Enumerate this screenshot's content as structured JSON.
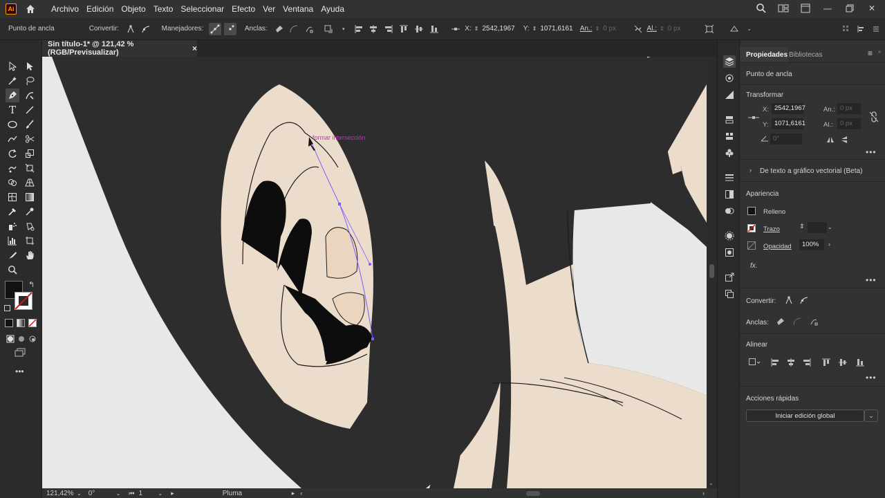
{
  "app": {
    "logo": "Ai"
  },
  "menubar": {
    "items": [
      "Archivo",
      "Edición",
      "Objeto",
      "Texto",
      "Seleccionar",
      "Efecto",
      "Ver",
      "Ventana",
      "Ayuda"
    ]
  },
  "controlbar": {
    "mode_label": "Punto de ancla",
    "convertir_label": "Convertir:",
    "manejadores_label": "Manejadores:",
    "anclas_label": "Anclas:",
    "x_label": "X:",
    "x_value": "2542,1967",
    "y_label": "Y:",
    "y_value": "1071,6161",
    "an_label": "An.:",
    "an_value": "0 px",
    "al_label": "Al.:",
    "al_value": "0 px"
  },
  "document": {
    "tab_title": "Sin título-1* @ 121,42 % (RGB/Previsualizar)",
    "close": "×"
  },
  "canvas": {
    "smart_guide_tip": "formar intersección"
  },
  "statusbar": {
    "zoom": "121,42%",
    "rotation": "0°",
    "artboard": "1",
    "tool": "Pluma"
  },
  "properties": {
    "tabs": [
      "Propiedades",
      "Bibliotecas"
    ],
    "selection_type": "Punto de ancla",
    "transform": {
      "title": "Transformar",
      "x_label": "X:",
      "x_value": "2542,1967",
      "y_label": "Y:",
      "y_value": "1071,6161",
      "an_label": "An.:",
      "an_value": "0 px",
      "al_label": "Al.:",
      "al_value": "0 px",
      "angle_value": "0°"
    },
    "text_to_vector": "De texto a gráfico vectorial (Beta)",
    "appearance": {
      "title": "Apariencia",
      "fill_label": "Relleno",
      "stroke_label": "Trazo",
      "opacity_label": "Opacidad",
      "opacity_value": "100%",
      "fx": "fx."
    },
    "convertir_label": "Convertir:",
    "anclas_label": "Anclas:",
    "align_title": "Alinear",
    "quick_actions_title": "Acciones rápidas",
    "quick_action_button": "Iniciar edición global"
  },
  "colors": {
    "fill": "#111111",
    "stroke": "#ffffff",
    "hair": "#2d2d2d",
    "skin": "#ecdccb",
    "path": "#7a5cff",
    "tip": "#c72fc7"
  }
}
